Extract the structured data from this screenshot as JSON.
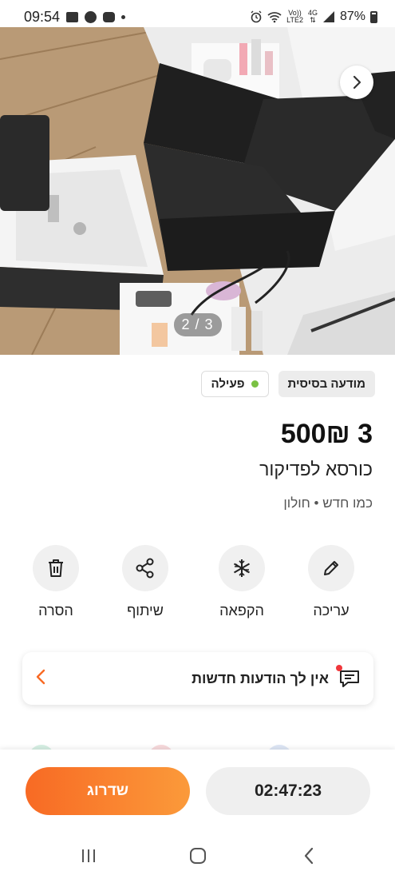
{
  "status_bar": {
    "time": "09:54",
    "network_top": "Vo))",
    "network_bottom": "LTE2",
    "network_type": "4G",
    "battery": "87%"
  },
  "gallery": {
    "counter": "2 / 3",
    "next_icon": "chevron-right-icon"
  },
  "listing": {
    "badge_basic": "מודעה בסיסית",
    "badge_active": "פעילה",
    "status_color": "#7ac143",
    "price": "3 500₪",
    "title": "כורסא לפדיקור",
    "subtitle": "כמו חדש • חולון"
  },
  "actions": [
    {
      "label": "עריכה",
      "icon": "pencil-icon"
    },
    {
      "label": "הקפאה",
      "icon": "snowflake-icon"
    },
    {
      "label": "שיתוף",
      "icon": "share-icon"
    },
    {
      "label": "הסרה",
      "icon": "trash-icon"
    }
  ],
  "notification": {
    "text": "אין לך הודעות חדשות",
    "icon": "chat-icon"
  },
  "bottom_bar": {
    "upgrade_label": "שדרוג",
    "timer": "02:47:23",
    "accent": "#f86a24"
  },
  "nav": {
    "recents_icon": "recents-icon",
    "home_icon": "home-icon",
    "back_icon": "back-icon"
  }
}
